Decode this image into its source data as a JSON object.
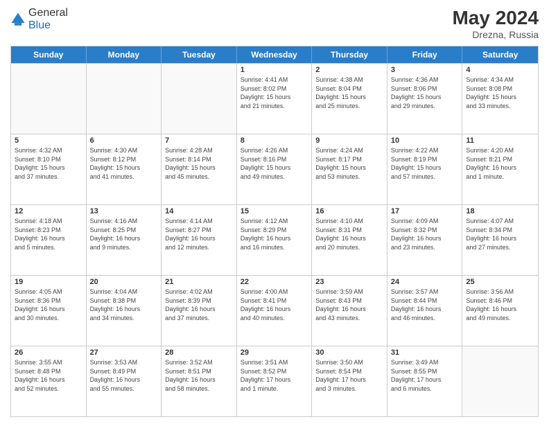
{
  "header": {
    "logo_general": "General",
    "logo_blue": "Blue",
    "month_year": "May 2024",
    "location": "Drezna, Russia"
  },
  "days_of_week": [
    "Sunday",
    "Monday",
    "Tuesday",
    "Wednesday",
    "Thursday",
    "Friday",
    "Saturday"
  ],
  "weeks": [
    [
      {
        "day": "",
        "info": ""
      },
      {
        "day": "",
        "info": ""
      },
      {
        "day": "",
        "info": ""
      },
      {
        "day": "1",
        "info": "Sunrise: 4:41 AM\nSunset: 8:02 PM\nDaylight: 15 hours\nand 21 minutes."
      },
      {
        "day": "2",
        "info": "Sunrise: 4:38 AM\nSunset: 8:04 PM\nDaylight: 15 hours\nand 25 minutes."
      },
      {
        "day": "3",
        "info": "Sunrise: 4:36 AM\nSunset: 8:06 PM\nDaylight: 15 hours\nand 29 minutes."
      },
      {
        "day": "4",
        "info": "Sunrise: 4:34 AM\nSunset: 8:08 PM\nDaylight: 15 hours\nand 33 minutes."
      }
    ],
    [
      {
        "day": "5",
        "info": "Sunrise: 4:32 AM\nSunset: 8:10 PM\nDaylight: 15 hours\nand 37 minutes."
      },
      {
        "day": "6",
        "info": "Sunrise: 4:30 AM\nSunset: 8:12 PM\nDaylight: 15 hours\nand 41 minutes."
      },
      {
        "day": "7",
        "info": "Sunrise: 4:28 AM\nSunset: 8:14 PM\nDaylight: 15 hours\nand 45 minutes."
      },
      {
        "day": "8",
        "info": "Sunrise: 4:26 AM\nSunset: 8:16 PM\nDaylight: 15 hours\nand 49 minutes."
      },
      {
        "day": "9",
        "info": "Sunrise: 4:24 AM\nSunset: 8:17 PM\nDaylight: 15 hours\nand 53 minutes."
      },
      {
        "day": "10",
        "info": "Sunrise: 4:22 AM\nSunset: 8:19 PM\nDaylight: 15 hours\nand 57 minutes."
      },
      {
        "day": "11",
        "info": "Sunrise: 4:20 AM\nSunset: 8:21 PM\nDaylight: 16 hours\nand 1 minute."
      }
    ],
    [
      {
        "day": "12",
        "info": "Sunrise: 4:18 AM\nSunset: 8:23 PM\nDaylight: 16 hours\nand 5 minutes."
      },
      {
        "day": "13",
        "info": "Sunrise: 4:16 AM\nSunset: 8:25 PM\nDaylight: 16 hours\nand 9 minutes."
      },
      {
        "day": "14",
        "info": "Sunrise: 4:14 AM\nSunset: 8:27 PM\nDaylight: 16 hours\nand 12 minutes."
      },
      {
        "day": "15",
        "info": "Sunrise: 4:12 AM\nSunset: 8:29 PM\nDaylight: 16 hours\nand 16 minutes."
      },
      {
        "day": "16",
        "info": "Sunrise: 4:10 AM\nSunset: 8:31 PM\nDaylight: 16 hours\nand 20 minutes."
      },
      {
        "day": "17",
        "info": "Sunrise: 4:09 AM\nSunset: 8:32 PM\nDaylight: 16 hours\nand 23 minutes."
      },
      {
        "day": "18",
        "info": "Sunrise: 4:07 AM\nSunset: 8:34 PM\nDaylight: 16 hours\nand 27 minutes."
      }
    ],
    [
      {
        "day": "19",
        "info": "Sunrise: 4:05 AM\nSunset: 8:36 PM\nDaylight: 16 hours\nand 30 minutes."
      },
      {
        "day": "20",
        "info": "Sunrise: 4:04 AM\nSunset: 8:38 PM\nDaylight: 16 hours\nand 34 minutes."
      },
      {
        "day": "21",
        "info": "Sunrise: 4:02 AM\nSunset: 8:39 PM\nDaylight: 16 hours\nand 37 minutes."
      },
      {
        "day": "22",
        "info": "Sunrise: 4:00 AM\nSunset: 8:41 PM\nDaylight: 16 hours\nand 40 minutes."
      },
      {
        "day": "23",
        "info": "Sunrise: 3:59 AM\nSunset: 8:43 PM\nDaylight: 16 hours\nand 43 minutes."
      },
      {
        "day": "24",
        "info": "Sunrise: 3:57 AM\nSunset: 8:44 PM\nDaylight: 16 hours\nand 46 minutes."
      },
      {
        "day": "25",
        "info": "Sunrise: 3:56 AM\nSunset: 8:46 PM\nDaylight: 16 hours\nand 49 minutes."
      }
    ],
    [
      {
        "day": "26",
        "info": "Sunrise: 3:55 AM\nSunset: 8:48 PM\nDaylight: 16 hours\nand 52 minutes."
      },
      {
        "day": "27",
        "info": "Sunrise: 3:53 AM\nSunset: 8:49 PM\nDaylight: 16 hours\nand 55 minutes."
      },
      {
        "day": "28",
        "info": "Sunrise: 3:52 AM\nSunset: 8:51 PM\nDaylight: 16 hours\nand 58 minutes."
      },
      {
        "day": "29",
        "info": "Sunrise: 3:51 AM\nSunset: 8:52 PM\nDaylight: 17 hours\nand 1 minute."
      },
      {
        "day": "30",
        "info": "Sunrise: 3:50 AM\nSunset: 8:54 PM\nDaylight: 17 hours\nand 3 minutes."
      },
      {
        "day": "31",
        "info": "Sunrise: 3:49 AM\nSunset: 8:55 PM\nDaylight: 17 hours\nand 6 minutes."
      },
      {
        "day": "",
        "info": ""
      }
    ]
  ]
}
